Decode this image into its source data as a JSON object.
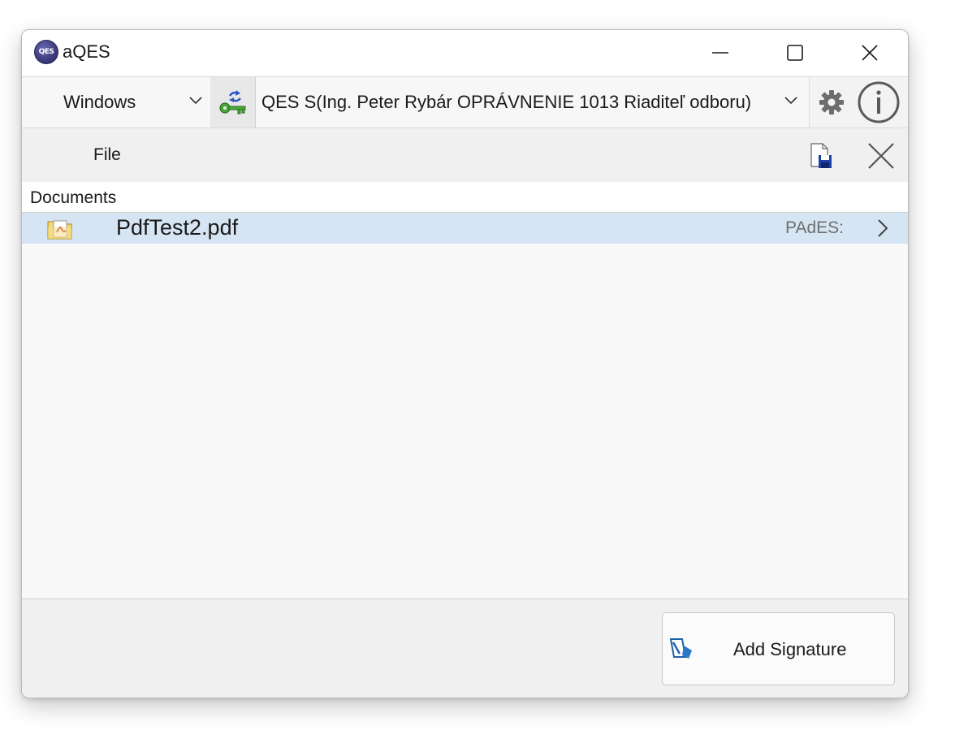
{
  "window": {
    "title": "aQES",
    "app_icon_text": "QES",
    "controls": {
      "minimize_icon": "minimize-icon",
      "maximize_icon": "maximize-icon",
      "close_icon": "close-icon"
    }
  },
  "toolbar": {
    "store_select": {
      "value": "Windows"
    },
    "certificate_icon": "certificate-key-icon",
    "certificate_select": {
      "value": "QES S(Ing. Peter Rybár OPRÁVNENIE 1013 Riaditeľ odboru)"
    },
    "settings_icon": "gear-icon",
    "info_icon": "info-icon"
  },
  "filebar": {
    "label": "File",
    "save_icon": "save-document-icon",
    "close_icon": "close-icon"
  },
  "documents": {
    "header": "Documents",
    "items": [
      {
        "name": "PdfTest2.pdf",
        "type": "PAdES:",
        "icon": "pdf-folder-icon"
      }
    ]
  },
  "footer": {
    "add_signature_label": "Add Signature",
    "add_signature_icon": "signature-icon"
  },
  "colors": {
    "selected_row": "#d6e5f3",
    "window_bg": "#f9f9f9",
    "bar_bg": "#f0f0f0"
  }
}
